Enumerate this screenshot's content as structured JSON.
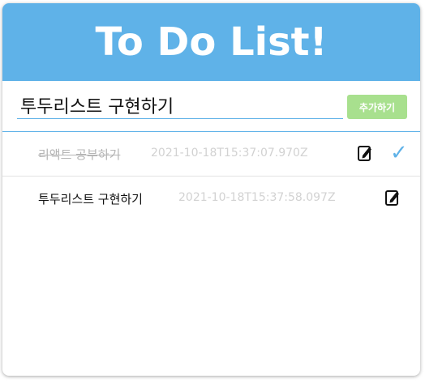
{
  "header": {
    "title": "To Do List!"
  },
  "form": {
    "input_value": "투두리스트 구현하기",
    "add_button_label": "추가하기"
  },
  "todos": [
    {
      "text": "리액트 공부하기",
      "date": "2021-10-18T15:37:07.970Z",
      "completed": true,
      "icons": [
        "edit-icon",
        "check-icon"
      ]
    },
    {
      "text": "투두리스트 구현하기",
      "date": "2021-10-18T15:37:58.097Z",
      "completed": false,
      "icons": [
        "edit-icon"
      ]
    }
  ],
  "colors": {
    "accent": "#5fb2e8",
    "add_button": "#a8e08e",
    "date_text": "#d2d2d2",
    "done_text": "#b5b5b5"
  }
}
